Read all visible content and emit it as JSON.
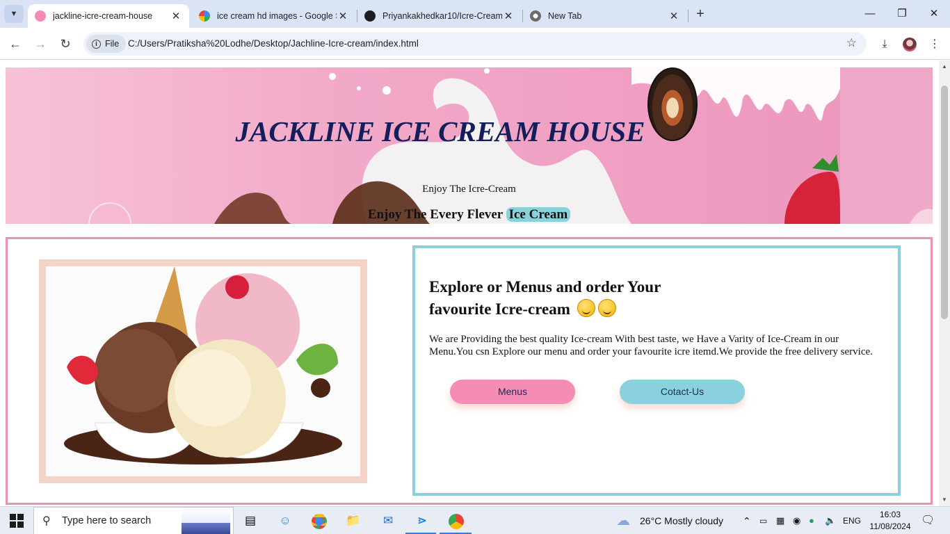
{
  "browser": {
    "tabs": [
      {
        "title": "jackline-icre-cream-house",
        "active": true
      },
      {
        "title": "ice cream hd images - Google S",
        "active": false
      },
      {
        "title": "Priyankakhedkar10/Icre-Cream",
        "active": false
      },
      {
        "title": "New Tab",
        "active": false
      }
    ],
    "address_chip": "File",
    "url": "C:/Users/Pratiksha%20Lodhe/Desktop/Jachline-Icre-cream/index.html"
  },
  "hero": {
    "title": "JACKLINE ICE CREAM HOUSE",
    "subtitle": "Enjoy The Icre-Cream",
    "tagline_prefix": "Enjoy The Every Flever",
    "tagline_highlight": "Ice Cream"
  },
  "main": {
    "heading": "Explore or Menus and order Your favourite Icre-cream",
    "description": "We are Providing the best quality Ice-cream With best taste, we Have a Varity of Ice-Cream in our Menu.You csn Explore our menu and order your favourite icre itemd.We provide the free delivery service.",
    "menus_button": "Menus",
    "contact_button": "Cotact-Us"
  },
  "taskbar": {
    "search_placeholder": "Type here to search",
    "weather": "26°C  Mostly cloudy",
    "language": "ENG",
    "time": "16:03",
    "date": "11/08/2024"
  },
  "colors": {
    "pink_accent": "#ef8fb8",
    "teal_accent": "#8ad1dd",
    "title_navy": "#141e5b",
    "image_frame": "#f5d4c8"
  }
}
